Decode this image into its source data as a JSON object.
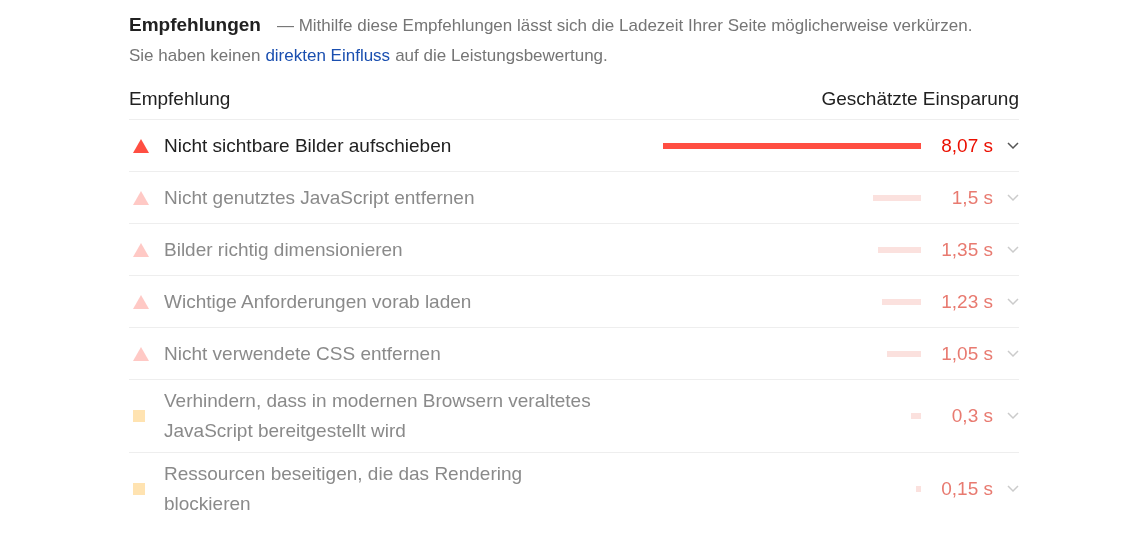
{
  "section": {
    "title": "Empfehlungen",
    "description": "— Mithilfe diese Empfehlungen lässt sich die Ladezeit Ihrer Seite möglicherweise verkürzen.",
    "note_before": "Sie haben keinen",
    "note_link": "direkten Einfluss",
    "note_after": "auf die Leistungsbewertung."
  },
  "columns": [
    "Empfehlung",
    "Geschätzte Einsparung"
  ],
  "rows": [
    {
      "kind": "fail",
      "dimmed": false,
      "title": "Nicht sichtbare Bilder aufschieben",
      "saving": "8,07 s"
    },
    {
      "kind": "fail",
      "dimmed": true,
      "title": "Nicht genutztes JavaScript entfernen",
      "saving": "1,5 s"
    },
    {
      "kind": "fail",
      "dimmed": true,
      "title": "Bilder richtig dimensionieren",
      "saving": "1,35 s"
    },
    {
      "kind": "fail",
      "dimmed": true,
      "title": "Wichtige Anforderungen vorab laden",
      "saving": "1,23 s"
    },
    {
      "kind": "fail",
      "dimmed": true,
      "title": "Nicht verwendete CSS entfernen",
      "saving": "1,05 s"
    },
    {
      "kind": "average",
      "dimmed": true,
      "title": "Verhindern, dass in modernen Browsern veraltetes JavaScript bereitgestellt wird",
      "saving": "0,3 s"
    },
    {
      "kind": "average",
      "dimmed": true,
      "title": "Ressourcen beseitigen, die das Rendering blockieren",
      "saving": "0,15 s"
    }
  ]
}
